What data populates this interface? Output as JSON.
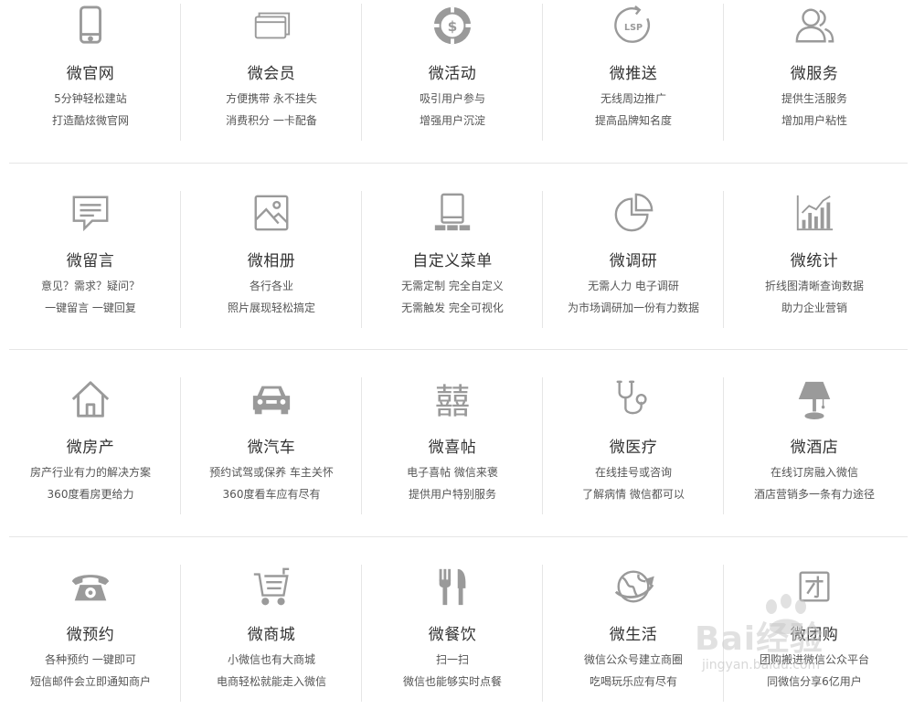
{
  "rows": [
    [
      {
        "icon": "phone-icon",
        "title": "微官网",
        "line1": "5分钟轻松建站",
        "line2": "打造酷炫微官网"
      },
      {
        "icon": "member-card-icon",
        "title": "微会员",
        "line1": "方便携带 永不挂失",
        "line2": "消费积分 一卡配备"
      },
      {
        "icon": "activity-dollar-icon",
        "title": "微活动",
        "line1": "吸引用户参与",
        "line2": "增强用户沉淀"
      },
      {
        "icon": "lsp-icon",
        "title": "微推送",
        "line1": "无线周边推广",
        "line2": "提高品牌知名度"
      },
      {
        "icon": "user-service-icon",
        "title": "微服务",
        "line1": "提供生活服务",
        "line2": "增加用户粘性"
      }
    ],
    [
      {
        "icon": "message-icon",
        "title": "微留言",
        "line1": "意见？需求？疑问？",
        "line2": "一键留言  一键回复"
      },
      {
        "icon": "photo-icon",
        "title": "微相册",
        "line1": "各行各业",
        "line2": "照片展现轻松搞定"
      },
      {
        "icon": "tablet-menu-icon",
        "title": "自定义菜单",
        "line1": "无需定制 完全自定义",
        "line2": "无需触发 完全可视化"
      },
      {
        "icon": "pie-chart-icon",
        "title": "微调研",
        "line1": "无需人力 电子调研",
        "line2": "为市场调研加一份有力数据"
      },
      {
        "icon": "bar-chart-icon",
        "title": "微统计",
        "line1": "折线图清晰查询数据",
        "line2": "助力企业营销"
      }
    ],
    [
      {
        "icon": "house-icon",
        "title": "微房产",
        "line1": "房产行业有力的解决方案",
        "line2": "360度看房更给力"
      },
      {
        "icon": "car-icon",
        "title": "微汽车",
        "line1": "预约试驾或保养 车主关怀",
        "line2": "360度看车应有尽有"
      },
      {
        "icon": "double-happiness-icon",
        "title": "微喜帖",
        "line1": "电子喜帖 微信来褒",
        "line2": "提供用户特别服务"
      },
      {
        "icon": "stethoscope-icon",
        "title": "微医疗",
        "line1": "在线挂号或咨询",
        "line2": "了解病情 微信都可以"
      },
      {
        "icon": "lamp-icon",
        "title": "微酒店",
        "line1": "在线订房融入微信",
        "line2": "酒店营销多一条有力途径"
      }
    ],
    [
      {
        "icon": "telephone-icon",
        "title": "微预约",
        "line1": "各种预约 一键即可",
        "line2": "短信邮件会立即通知商户"
      },
      {
        "icon": "shopping-cart-icon",
        "title": "微商城",
        "line1": "小微信也有大商城",
        "line2": "电商轻松就能走入微信"
      },
      {
        "icon": "fork-knife-icon",
        "title": "微餐饮",
        "line1": "扫一扫",
        "line2": "微信也能够实时点餐"
      },
      {
        "icon": "globe-plane-icon",
        "title": "微生活",
        "line1": "微信公众号建立商圈",
        "line2": "吃喝玩乐应有尽有"
      },
      {
        "icon": "group-buy-icon",
        "title": "微团购",
        "line1": "团购搬进微信公众平台",
        "line2": "同微信分享6亿用户"
      }
    ]
  ],
  "watermark": {
    "text": "Bai经验",
    "sub": "jingyan.baidu.com"
  },
  "colors": {
    "icon": "#9a9a9a",
    "divider": "#e6e6e6",
    "title": "#333333",
    "text": "#555555"
  }
}
